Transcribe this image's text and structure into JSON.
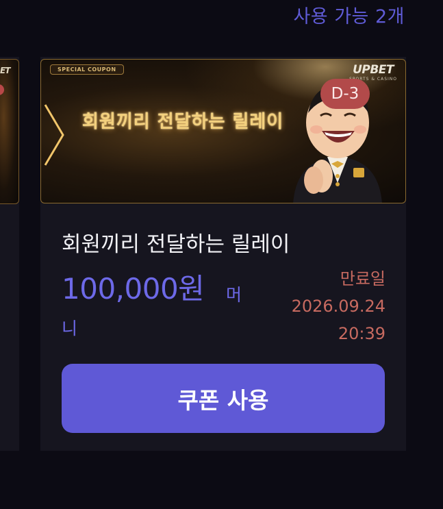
{
  "header": {
    "available_count": "사용 가능 2개"
  },
  "side_card": {
    "logo_text": "ET"
  },
  "coupon": {
    "banner_tag": "SPECIAL COUPON",
    "banner_title": "회원끼리 전달하는 릴레이",
    "banner_logo": "UPBET",
    "banner_logo_sub": "SPORTS & CASINO",
    "dday": "D-3",
    "name": "회원끼리 전달하는 릴레이",
    "amount": "100,000원",
    "currency_unit_part1": "머",
    "currency_unit_part2": "니",
    "expiry_label": "만료일",
    "expiry_date": "2026.09.24",
    "expiry_time": "20:39",
    "use_button_label": "쿠폰 사용"
  },
  "colors": {
    "accent": "#5f59d6",
    "amount": "#6d69e8",
    "expiry": "#c76a60",
    "dday_badge": "#b24a4a",
    "card_bg": "#16151f",
    "page_bg": "#0c0b14"
  },
  "icons": {
    "banner_chevron": "chevron-right-icon",
    "mascot": "mascot-illustration"
  }
}
